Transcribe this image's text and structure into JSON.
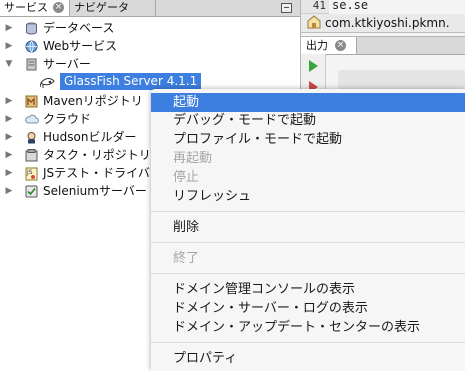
{
  "services_panel": {
    "tabs": [
      {
        "label": "サービス"
      },
      {
        "label": "ナビゲータ"
      }
    ],
    "tree": [
      {
        "label": "データベース",
        "icon": "database-icon",
        "expanded": false
      },
      {
        "label": "Webサービス",
        "icon": "web-services-icon",
        "expanded": false
      },
      {
        "label": "サーバー",
        "icon": "server-icon",
        "expanded": true
      },
      {
        "label": "GlassFish Server 4.1.1",
        "icon": "glassfish-icon",
        "selected": true
      },
      {
        "label": "Mavenリポジトリ",
        "icon": "maven-icon",
        "expanded": false
      },
      {
        "label": "クラウド",
        "icon": "cloud-icon",
        "expanded": false
      },
      {
        "label": "Hudsonビルダー",
        "icon": "hudson-icon",
        "expanded": false
      },
      {
        "label": "タスク・リポジトリ",
        "icon": "task-repository-icon",
        "expanded": false
      },
      {
        "label": "JSテスト・ドライバ",
        "icon": "js-test-driver-icon",
        "expanded": false
      },
      {
        "label": "Seleniumサーバー",
        "icon": "selenium-icon",
        "expanded": false
      }
    ]
  },
  "editor": {
    "line_number": "41",
    "code_line": "se.se",
    "file_tab": "com.ktkiyoshi.pkmn."
  },
  "output": {
    "tab_label": "出力"
  },
  "context_menu": {
    "items": [
      {
        "label": "起動",
        "enabled": true,
        "selected": true
      },
      {
        "label": "デバッグ・モードで起動",
        "enabled": true
      },
      {
        "label": "プロファイル・モードで起動",
        "enabled": true
      },
      {
        "label": "再起動",
        "enabled": false
      },
      {
        "label": "停止",
        "enabled": false
      },
      {
        "label": "リフレッシュ",
        "enabled": true
      },
      {
        "label": "削除",
        "enabled": true
      },
      {
        "label": "終了",
        "enabled": false
      },
      {
        "label": "ドメイン管理コンソールの表示",
        "enabled": true
      },
      {
        "label": "ドメイン・サーバー・ログの表示",
        "enabled": true
      },
      {
        "label": "ドメイン・アップデート・センターの表示",
        "enabled": true
      },
      {
        "label": "プロパティ",
        "enabled": true
      }
    ]
  },
  "colors": {
    "selection": "#3d7fe0",
    "menu_background": "#f6f6f6",
    "disabled_text": "#a6a6a6",
    "run_green": "#3aa53a"
  }
}
